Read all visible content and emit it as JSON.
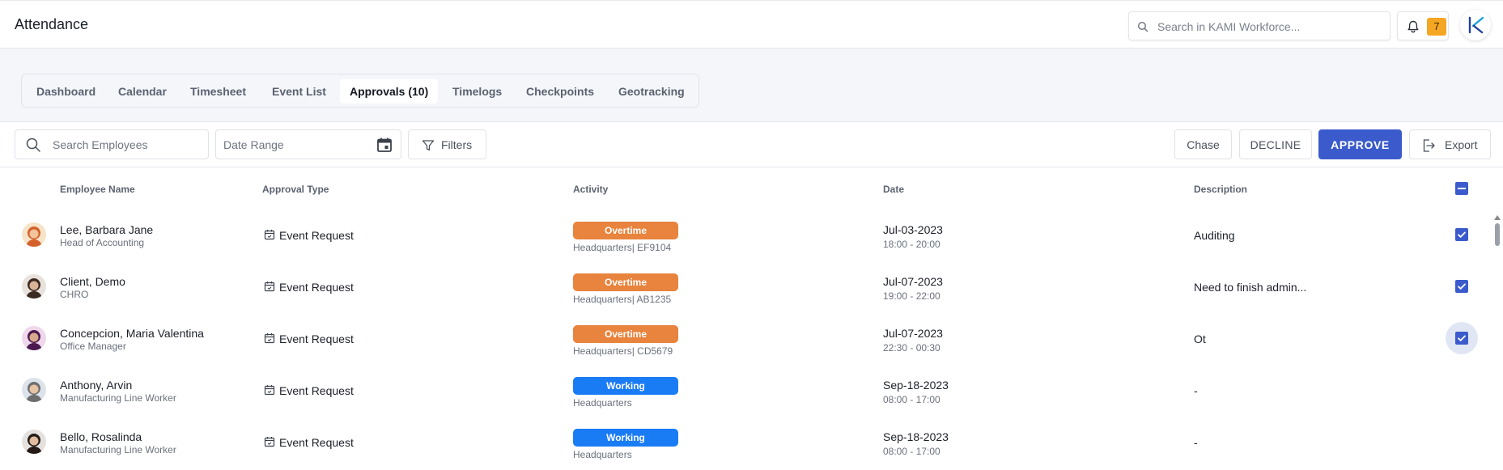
{
  "header": {
    "title": "Attendance",
    "search_placeholder": "Search in KAMI Workforce...",
    "notification_count": "7"
  },
  "tabs": [
    {
      "label": "Dashboard",
      "active": false
    },
    {
      "label": "Calendar",
      "active": false
    },
    {
      "label": "Timesheet",
      "active": false
    },
    {
      "label": "Event List",
      "active": false
    },
    {
      "label": "Approvals (10)",
      "active": true
    },
    {
      "label": "Timelogs",
      "active": false
    },
    {
      "label": "Checkpoints",
      "active": false
    },
    {
      "label": "Geotracking",
      "active": false
    }
  ],
  "toolbar": {
    "employee_search_placeholder": "Search Employees",
    "date_range_placeholder": "Date Range",
    "filters_label": "Filters",
    "chase_label": "Chase",
    "decline_label": "DECLINE",
    "approve_label": "APPROVE",
    "export_label": "Export"
  },
  "table": {
    "columns": [
      "Employee Name",
      "Approval Type",
      "Activity",
      "Date",
      "Description"
    ],
    "rows": [
      {
        "name": "Lee, Barbara Jane",
        "role": "Head of Accounting",
        "approval_type": "Event Request",
        "activity": "Overtime",
        "activity_color": "#e8843e",
        "location": "Headquarters| EF9104",
        "date": "Jul-03-2023",
        "time": "18:00 - 20:00",
        "description": "Auditing",
        "checked": true
      },
      {
        "name": "Client, Demo",
        "role": "CHRO",
        "approval_type": "Event Request",
        "activity": "Overtime",
        "activity_color": "#e8843e",
        "location": "Headquarters| AB1235",
        "date": "Jul-07-2023",
        "time": "19:00 - 22:00",
        "description": "Need to finish admin...",
        "checked": true
      },
      {
        "name": "Concepcion, Maria Valentina",
        "role": "Office Manager",
        "approval_type": "Event Request",
        "activity": "Overtime",
        "activity_color": "#e8843e",
        "location": "Headquarters| CD5679",
        "date": "Jul-07-2023",
        "time": "22:30 - 00:30",
        "description": "Ot",
        "checked": true
      },
      {
        "name": "Anthony, Arvin",
        "role": "Manufacturing Line Worker",
        "approval_type": "Event Request",
        "activity": "Working",
        "activity_color": "#1a7cf5",
        "location": "Headquarters",
        "date": "Sep-18-2023",
        "time": "08:00 - 17:00",
        "description": "-",
        "checked": false
      },
      {
        "name": "Bello, Rosalinda",
        "role": "Manufacturing Line Worker",
        "approval_type": "Event Request",
        "activity": "Working",
        "activity_color": "#1a7cf5",
        "location": "Headquarters",
        "date": "Sep-18-2023",
        "time": "08:00 - 17:00",
        "description": "-",
        "checked": false
      }
    ]
  },
  "colors": {
    "primary": "#3b5bcc",
    "overtime": "#e8843e",
    "working": "#1a7cf5",
    "badge": "#f5a623"
  }
}
